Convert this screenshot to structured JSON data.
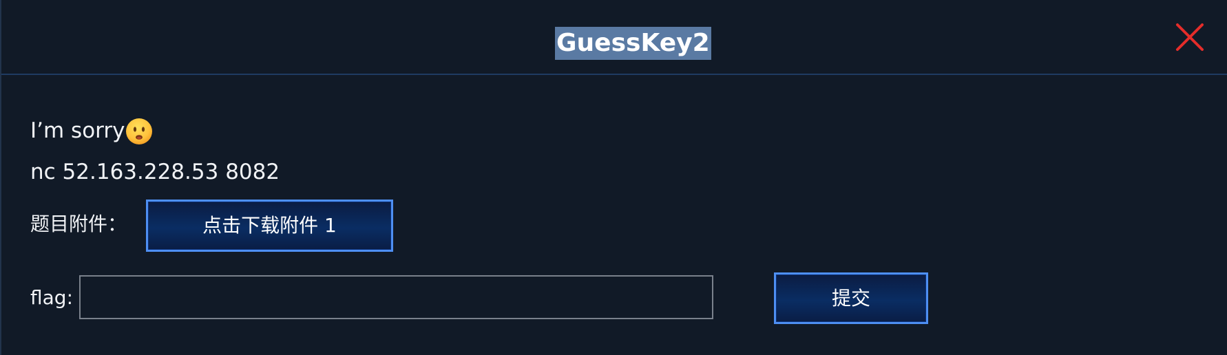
{
  "dialog": {
    "title": "GuessKey2",
    "close_icon": "close-icon",
    "colors": {
      "background": "#111a27",
      "title_highlight": "#5a7aa3",
      "close_icon": "#e52d2a",
      "button_border": "#4e8ff3"
    }
  },
  "message": {
    "sorry_text": "I’m sorry",
    "emoji": "frowning-face-emoji",
    "server": "nc 52.163.228.53 8082"
  },
  "attachment": {
    "label": "题目附件：",
    "button_label": "点击下载附件 1"
  },
  "flag": {
    "label": "flag:",
    "value": "",
    "placeholder": "",
    "submit_label": "提交"
  }
}
